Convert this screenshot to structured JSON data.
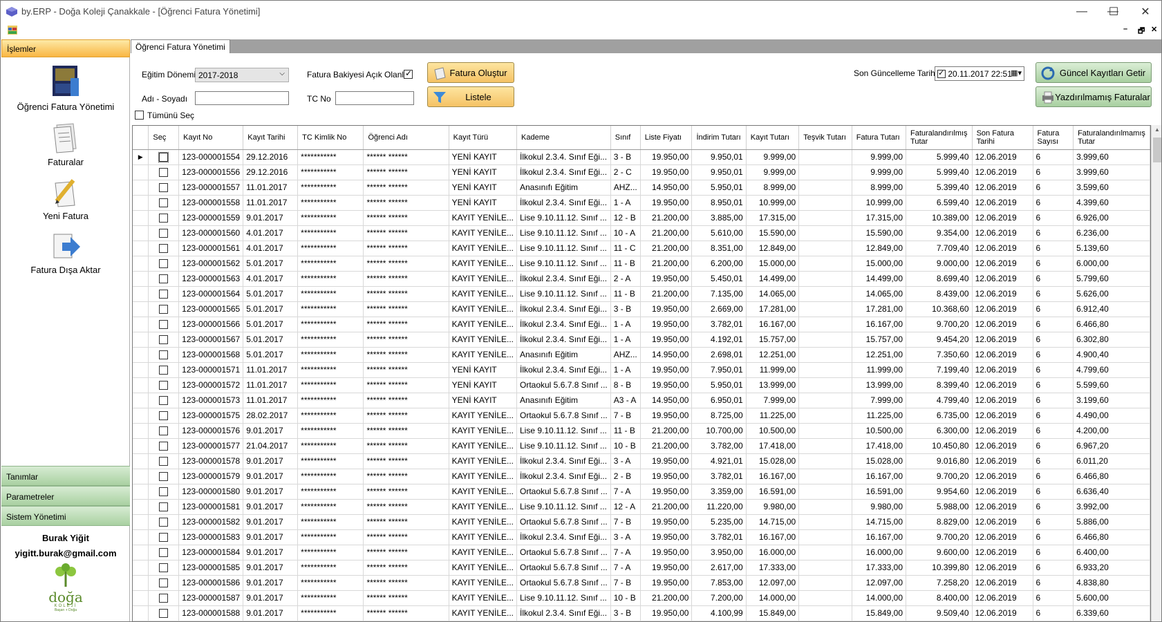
{
  "window": {
    "title": "by.ERP - Doğa Koleji Çanakkale - [Öğrenci Fatura Yönetimi]",
    "minimize": "—",
    "maximize": "☐",
    "close": "✕"
  },
  "mdi": {
    "minimize": "–",
    "restore": "🗗",
    "close": "✕"
  },
  "sidebar": {
    "active_group": "İşlemler",
    "items": [
      {
        "label": "Öğrenci Fatura Yönetimi"
      },
      {
        "label": "Faturalar"
      },
      {
        "label": "Yeni Fatura"
      },
      {
        "label": "Fatura Dışa Aktar"
      }
    ],
    "groups": [
      "Tanımlar",
      "Parametreler",
      "Sistem Yönetimi"
    ],
    "user_name": "Burak Yiğit",
    "user_email": "yigitt.burak@gmail.com",
    "logo_text": "doğa",
    "logo_sub": "KOLEJİ",
    "logo_tag": "Başarı + Doğa"
  },
  "tab": {
    "label": "Öğrenci Fatura Yönetimi"
  },
  "filters": {
    "period_label": "Eğitim Dönemi",
    "period_value": "2017-2018",
    "open_balance_label": "Fatura Bakiyesi Açık Olanlar",
    "name_label": "Adı - Soyadı",
    "name_value": "",
    "tc_label": "TC No",
    "tc_value": "",
    "select_all_label": "Tümünü Seç",
    "last_update_label": "Son Güncelleme Tarihi",
    "last_update_value": "20.11.2017 22:51"
  },
  "buttons": {
    "create_invoice": "Fatura Oluştur",
    "list": "Listele",
    "fetch_current": "Güncel Kayıtları Getir",
    "unprinted": "Yazdırılmamış Faturalar"
  },
  "colors": {
    "accent_orange": "#f9b643",
    "accent_green": "#a9d0a1"
  },
  "grid": {
    "columns": [
      "Seç",
      "Kayıt No",
      "Kayıt Tarihi",
      "TC Kimlik No",
      "Öğrenci Adı",
      "Kayıt Türü",
      "Kademe",
      "Sınıf",
      "Liste Fiyatı",
      "İndirim Tutarı",
      "Kayıt Tutarı",
      "Teşvik Tutarı",
      "Fatura Tutarı",
      "Faturalandırılmış Tutar",
      "Son Fatura Tarihi",
      "Fatura Sayısı",
      "Faturalandırılmamış Tutar"
    ],
    "rows": [
      [
        "123-000001554",
        "29.12.2016",
        "***********",
        "****** ******",
        "YENİ KAYIT",
        "İlkokul 2.3.4. Sınıf Eği...",
        "3 - B",
        "19.950,00",
        "9.950,01",
        "9.999,00",
        "",
        "9.999,00",
        "5.999,40",
        "12.06.2019",
        "6",
        "3.999,60"
      ],
      [
        "123-000001556",
        "29.12.2016",
        "***********",
        "****** ******",
        "YENİ KAYIT",
        "İlkokul 2.3.4. Sınıf Eği...",
        "2 - C",
        "19.950,00",
        "9.950,01",
        "9.999,00",
        "",
        "9.999,00",
        "5.999,40",
        "12.06.2019",
        "6",
        "3.999,60"
      ],
      [
        "123-000001557",
        "11.01.2017",
        "***********",
        "****** ******",
        "YENİ KAYIT",
        "Anasınıfı Eğitim",
        "AHZ...",
        "14.950,00",
        "5.950,01",
        "8.999,00",
        "",
        "8.999,00",
        "5.399,40",
        "12.06.2019",
        "6",
        "3.599,60"
      ],
      [
        "123-000001558",
        "11.01.2017",
        "***********",
        "****** ******",
        "YENİ KAYIT",
        "İlkokul 2.3.4. Sınıf Eği...",
        "1 - A",
        "19.950,00",
        "8.950,01",
        "10.999,00",
        "",
        "10.999,00",
        "6.599,40",
        "12.06.2019",
        "6",
        "4.399,60"
      ],
      [
        "123-000001559",
        "9.01.2017",
        "***********",
        "****** ******",
        "KAYIT YENİLE...",
        "Lise 9.10.11.12. Sınıf ...",
        "12 - B",
        "21.200,00",
        "3.885,00",
        "17.315,00",
        "",
        "17.315,00",
        "10.389,00",
        "12.06.2019",
        "6",
        "6.926,00"
      ],
      [
        "123-000001560",
        "4.01.2017",
        "***********",
        "****** ******",
        "KAYIT YENİLE...",
        "Lise 9.10.11.12. Sınıf ...",
        "10 - A",
        "21.200,00",
        "5.610,00",
        "15.590,00",
        "",
        "15.590,00",
        "9.354,00",
        "12.06.2019",
        "6",
        "6.236,00"
      ],
      [
        "123-000001561",
        "4.01.2017",
        "***********",
        "****** ******",
        "KAYIT YENİLE...",
        "Lise 9.10.11.12. Sınıf ...",
        "11 - C",
        "21.200,00",
        "8.351,00",
        "12.849,00",
        "",
        "12.849,00",
        "7.709,40",
        "12.06.2019",
        "6",
        "5.139,60"
      ],
      [
        "123-000001562",
        "5.01.2017",
        "***********",
        "****** ******",
        "KAYIT YENİLE...",
        "Lise 9.10.11.12. Sınıf ...",
        "11 - B",
        "21.200,00",
        "6.200,00",
        "15.000,00",
        "",
        "15.000,00",
        "9.000,00",
        "12.06.2019",
        "6",
        "6.000,00"
      ],
      [
        "123-000001563",
        "4.01.2017",
        "***********",
        "****** ******",
        "KAYIT YENİLE...",
        "İlkokul 2.3.4. Sınıf Eği...",
        "2 - A",
        "19.950,00",
        "5.450,01",
        "14.499,00",
        "",
        "14.499,00",
        "8.699,40",
        "12.06.2019",
        "6",
        "5.799,60"
      ],
      [
        "123-000001564",
        "5.01.2017",
        "***********",
        "****** ******",
        "KAYIT YENİLE...",
        "Lise 9.10.11.12. Sınıf ...",
        "11 - B",
        "21.200,00",
        "7.135,00",
        "14.065,00",
        "",
        "14.065,00",
        "8.439,00",
        "12.06.2019",
        "6",
        "5.626,00"
      ],
      [
        "123-000001565",
        "5.01.2017",
        "***********",
        "****** ******",
        "KAYIT YENİLE...",
        "İlkokul 2.3.4. Sınıf Eği...",
        "3 - B",
        "19.950,00",
        "2.669,00",
        "17.281,00",
        "",
        "17.281,00",
        "10.368,60",
        "12.06.2019",
        "6",
        "6.912,40"
      ],
      [
        "123-000001566",
        "5.01.2017",
        "***********",
        "****** ******",
        "KAYIT YENİLE...",
        "İlkokul 2.3.4. Sınıf Eği...",
        "1 - A",
        "19.950,00",
        "3.782,01",
        "16.167,00",
        "",
        "16.167,00",
        "9.700,20",
        "12.06.2019",
        "6",
        "6.466,80"
      ],
      [
        "123-000001567",
        "5.01.2017",
        "***********",
        "****** ******",
        "KAYIT YENİLE...",
        "İlkokul 2.3.4. Sınıf Eği...",
        "1 - A",
        "19.950,00",
        "4.192,01",
        "15.757,00",
        "",
        "15.757,00",
        "9.454,20",
        "12.06.2019",
        "6",
        "6.302,80"
      ],
      [
        "123-000001568",
        "5.01.2017",
        "***********",
        "****** ******",
        "KAYIT YENİLE...",
        "Anasınıfı Eğitim",
        "AHZ...",
        "14.950,00",
        "2.698,01",
        "12.251,00",
        "",
        "12.251,00",
        "7.350,60",
        "12.06.2019",
        "6",
        "4.900,40"
      ],
      [
        "123-000001571",
        "11.01.2017",
        "***********",
        "****** ******",
        "YENİ KAYIT",
        "İlkokul 2.3.4. Sınıf Eği...",
        "1 - A",
        "19.950,00",
        "7.950,01",
        "11.999,00",
        "",
        "11.999,00",
        "7.199,40",
        "12.06.2019",
        "6",
        "4.799,60"
      ],
      [
        "123-000001572",
        "11.01.2017",
        "***********",
        "****** ******",
        "YENİ KAYIT",
        "Ortaokul 5.6.7.8 Sınıf ...",
        "8 - B",
        "19.950,00",
        "5.950,01",
        "13.999,00",
        "",
        "13.999,00",
        "8.399,40",
        "12.06.2019",
        "6",
        "5.599,60"
      ],
      [
        "123-000001573",
        "11.01.2017",
        "***********",
        "****** ******",
        "YENİ KAYIT",
        "Anasınıfı Eğitim",
        "A3 - A",
        "14.950,00",
        "6.950,01",
        "7.999,00",
        "",
        "7.999,00",
        "4.799,40",
        "12.06.2019",
        "6",
        "3.199,60"
      ],
      [
        "123-000001575",
        "28.02.2017",
        "***********",
        "****** ******",
        "KAYIT YENİLE...",
        "Ortaokul 5.6.7.8 Sınıf ...",
        "7 - B",
        "19.950,00",
        "8.725,00",
        "11.225,00",
        "",
        "11.225,00",
        "6.735,00",
        "12.06.2019",
        "6",
        "4.490,00"
      ],
      [
        "123-000001576",
        "9.01.2017",
        "***********",
        "****** ******",
        "KAYIT YENİLE...",
        "Lise 9.10.11.12. Sınıf ...",
        "11 - B",
        "21.200,00",
        "10.700,00",
        "10.500,00",
        "",
        "10.500,00",
        "6.300,00",
        "12.06.2019",
        "6",
        "4.200,00"
      ],
      [
        "123-000001577",
        "21.04.2017",
        "***********",
        "****** ******",
        "KAYIT YENİLE...",
        "Lise 9.10.11.12. Sınıf ...",
        "10 - B",
        "21.200,00",
        "3.782,00",
        "17.418,00",
        "",
        "17.418,00",
        "10.450,80",
        "12.06.2019",
        "6",
        "6.967,20"
      ],
      [
        "123-000001578",
        "9.01.2017",
        "***********",
        "****** ******",
        "KAYIT YENİLE...",
        "İlkokul 2.3.4. Sınıf Eği...",
        "3 - A",
        "19.950,00",
        "4.921,01",
        "15.028,00",
        "",
        "15.028,00",
        "9.016,80",
        "12.06.2019",
        "6",
        "6.011,20"
      ],
      [
        "123-000001579",
        "9.01.2017",
        "***********",
        "****** ******",
        "KAYIT YENİLE...",
        "İlkokul 2.3.4. Sınıf Eği...",
        "2 - B",
        "19.950,00",
        "3.782,01",
        "16.167,00",
        "",
        "16.167,00",
        "9.700,20",
        "12.06.2019",
        "6",
        "6.466,80"
      ],
      [
        "123-000001580",
        "9.01.2017",
        "***********",
        "****** ******",
        "KAYIT YENİLE...",
        "Ortaokul 5.6.7.8 Sınıf ...",
        "7 - A",
        "19.950,00",
        "3.359,00",
        "16.591,00",
        "",
        "16.591,00",
        "9.954,60",
        "12.06.2019",
        "6",
        "6.636,40"
      ],
      [
        "123-000001581",
        "9.01.2017",
        "***********",
        "****** ******",
        "KAYIT YENİLE...",
        "Lise 9.10.11.12. Sınıf ...",
        "12 - A",
        "21.200,00",
        "11.220,00",
        "9.980,00",
        "",
        "9.980,00",
        "5.988,00",
        "12.06.2019",
        "6",
        "3.992,00"
      ],
      [
        "123-000001582",
        "9.01.2017",
        "***********",
        "****** ******",
        "KAYIT YENİLE...",
        "Ortaokul 5.6.7.8 Sınıf ...",
        "7 - B",
        "19.950,00",
        "5.235,00",
        "14.715,00",
        "",
        "14.715,00",
        "8.829,00",
        "12.06.2019",
        "6",
        "5.886,00"
      ],
      [
        "123-000001583",
        "9.01.2017",
        "***********",
        "****** ******",
        "KAYIT YENİLE...",
        "İlkokul 2.3.4. Sınıf Eği...",
        "3 - A",
        "19.950,00",
        "3.782,01",
        "16.167,00",
        "",
        "16.167,00",
        "9.700,20",
        "12.06.2019",
        "6",
        "6.466,80"
      ],
      [
        "123-000001584",
        "9.01.2017",
        "***********",
        "****** ******",
        "KAYIT YENİLE...",
        "Ortaokul 5.6.7.8 Sınıf ...",
        "7 - A",
        "19.950,00",
        "3.950,00",
        "16.000,00",
        "",
        "16.000,00",
        "9.600,00",
        "12.06.2019",
        "6",
        "6.400,00"
      ],
      [
        "123-000001585",
        "9.01.2017",
        "***********",
        "****** ******",
        "KAYIT YENİLE...",
        "Ortaokul 5.6.7.8 Sınıf ...",
        "7 - A",
        "19.950,00",
        "2.617,00",
        "17.333,00",
        "",
        "17.333,00",
        "10.399,80",
        "12.06.2019",
        "6",
        "6.933,20"
      ],
      [
        "123-000001586",
        "9.01.2017",
        "***********",
        "****** ******",
        "KAYIT YENİLE...",
        "Ortaokul 5.6.7.8 Sınıf ...",
        "7 - B",
        "19.950,00",
        "7.853,00",
        "12.097,00",
        "",
        "12.097,00",
        "7.258,20",
        "12.06.2019",
        "6",
        "4.838,80"
      ],
      [
        "123-000001587",
        "9.01.2017",
        "***********",
        "****** ******",
        "KAYIT YENİLE...",
        "Lise 9.10.11.12. Sınıf ...",
        "10 - B",
        "21.200,00",
        "7.200,00",
        "14.000,00",
        "",
        "14.000,00",
        "8.400,00",
        "12.06.2019",
        "6",
        "5.600,00"
      ],
      [
        "123-000001588",
        "9.01.2017",
        "***********",
        "****** ******",
        "KAYIT YENİLE...",
        "İlkokul 2.3.4. Sınıf Eği...",
        "3 - B",
        "19.950,00",
        "4.100,99",
        "15.849,00",
        "",
        "15.849,00",
        "9.509,40",
        "12.06.2019",
        "6",
        "6.339,60"
      ]
    ]
  }
}
